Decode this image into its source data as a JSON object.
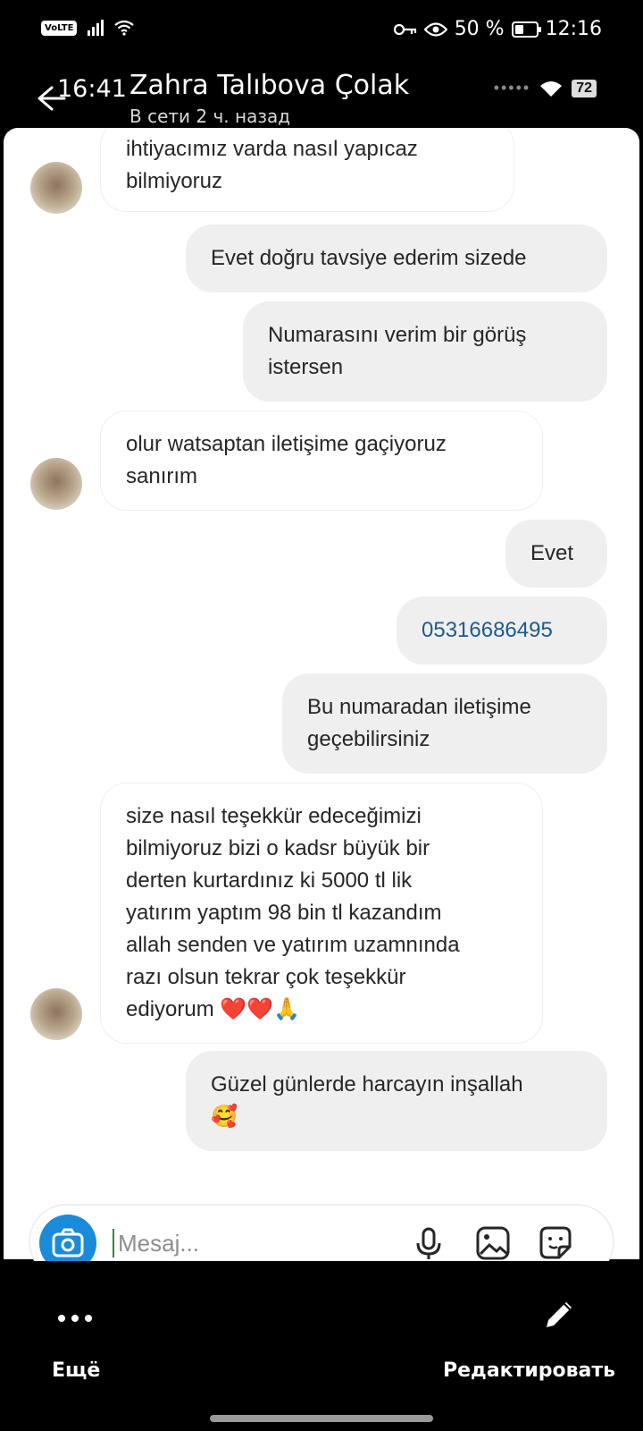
{
  "status_bar": {
    "network": "VoLTE",
    "battery_text": "50 %",
    "battery_level": 0.5,
    "time": "12:16"
  },
  "chat_header": {
    "inner_time": "16:41",
    "contact_name": "Zahra Talıbova Çolak",
    "status": "В сети 2 ч. назад",
    "inner_battery": "72"
  },
  "messages": [
    {
      "dir": "in",
      "text": "ihtiyacımız varda nasıl yapıcaz\nbilmiyoruz"
    },
    {
      "dir": "out",
      "text": "Evet doğru tavsiye ederim sizede"
    },
    {
      "dir": "out",
      "text": "Numarasını verim bir görüş\nistersen"
    },
    {
      "dir": "in",
      "text": "olur watsaptan iletişime gaçiyoruz\nsanırım"
    },
    {
      "dir": "out",
      "text": "Evet"
    },
    {
      "dir": "out",
      "text": "05316686495"
    },
    {
      "dir": "out",
      "text": "Bu numaradan iletişime\ngeçebilirsiniz"
    },
    {
      "dir": "in",
      "text": "size nasıl teşekkür edeceğimizi\nbilmiyoruz bizi o kadsr büyük bir\nderten kurtardınız ki 5000 tl lik\nyatırım yaptım 98 bin tl kazandım\nallah senden ve yatırım uzamnında\nrazı olsun tekrar çok teşekkür\nediyorum ❤️❤️🙏"
    },
    {
      "dir": "out",
      "text": "Güzel günlerde harcayın inşallah\n🥰"
    }
  ],
  "composer": {
    "placeholder": "Mesaj...",
    "icons": [
      "camera-icon",
      "microphone-icon",
      "image-icon",
      "sticker-icon"
    ]
  },
  "bottom_bar": {
    "more_label": "Ещё",
    "edit_label": "Редактировать"
  },
  "colors": {
    "camera_button": "#1a8bd9",
    "incoming_bubble_border": "#efefef",
    "outgoing_bubble": "#efefef",
    "phone_link": "#1e5a8c"
  }
}
